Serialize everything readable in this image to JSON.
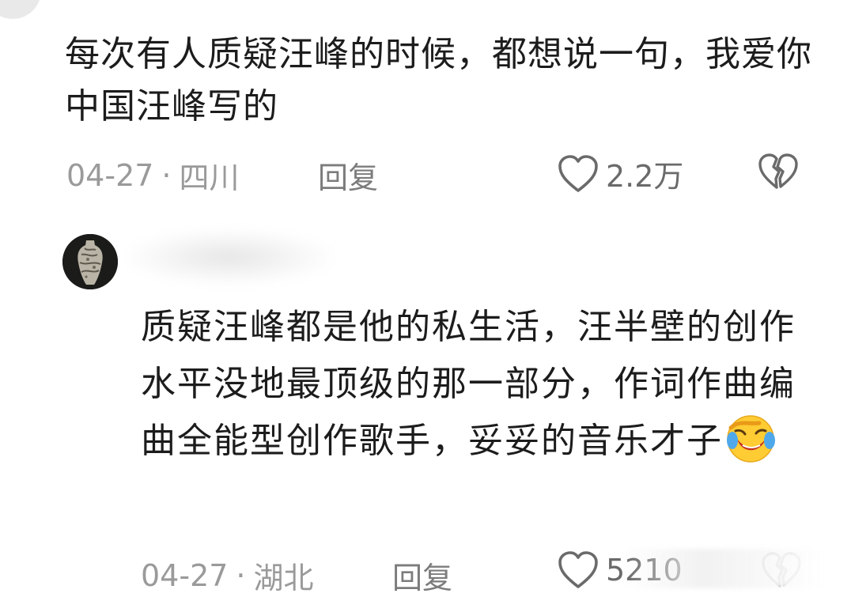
{
  "comments": [
    {
      "text": "每次有人质疑汪峰的时候，都想说一句，我爱你中国汪峰写的",
      "date": "04-27",
      "separator": "·",
      "location": "四川",
      "reply_label": "回复",
      "likes": "2.2万"
    },
    {
      "text": "质疑汪峰都是他的私生活，汪半壁的创作水平没地最顶级的那一部分，作词作曲编曲全能型创作歌手，妥妥的音乐才子",
      "emoji": "laughing-crying-emoji",
      "date": "04-27",
      "separator": "·",
      "location": "湖北",
      "reply_label": "回复",
      "likes": "5210"
    }
  ],
  "icons": {
    "like": "heart-outline-icon",
    "dislike": "broken-heart-icon"
  },
  "colors": {
    "text": "#1c1c1c",
    "meta": "#9a9a9a",
    "icon": "#6a6a6a"
  }
}
